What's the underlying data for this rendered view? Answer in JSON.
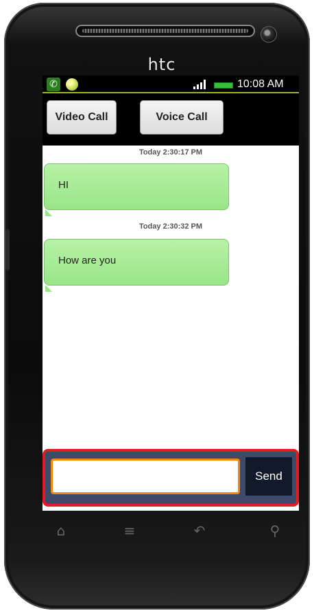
{
  "device": {
    "brand": "htc"
  },
  "statusbar": {
    "time": "10:08 AM"
  },
  "call_buttons": {
    "video": "Video Call",
    "voice": "Voice Call"
  },
  "messages": [
    {
      "timestamp": "Today 2:30:17 PM",
      "text": "HI"
    },
    {
      "timestamp": "Today 2:30:32 PM",
      "text": "How are you"
    }
  ],
  "compose": {
    "input_value": "",
    "placeholder": "",
    "send_label": "Send"
  },
  "colors": {
    "bubble": "#98e588",
    "compose_highlight": "#e31b23",
    "input_focus": "#f28a10",
    "statusbar_accent": "#9fb72a"
  },
  "icons": {
    "status": [
      "phone-call-icon",
      "notification-dot-icon",
      "signal-icon",
      "battery-icon"
    ],
    "navbar": [
      "home-icon",
      "menu-icon",
      "back-icon",
      "search-icon"
    ]
  }
}
